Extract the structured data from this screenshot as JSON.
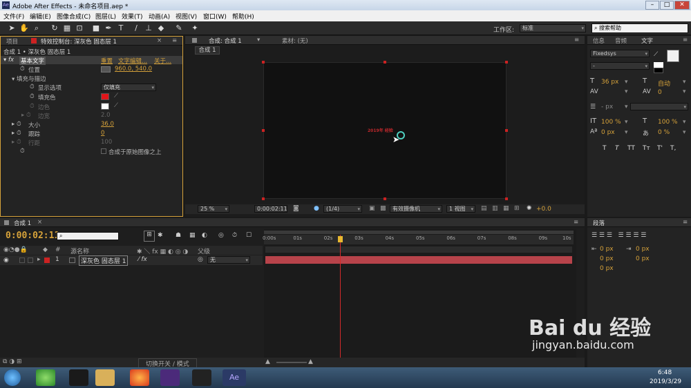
{
  "window": {
    "title": "Adobe After Effects - 未命名项目.aep *",
    "logo": "Ae"
  },
  "menu": [
    "文件(F)",
    "编辑(E)",
    "图像合成(C)",
    "图层(L)",
    "效果(T)",
    "动画(A)",
    "视图(V)",
    "窗口(W)",
    "帮助(H)"
  ],
  "toolbar": {
    "workspace_label": "工作区:",
    "workspace_value": "标准",
    "search_placeholder": "搜索帮助"
  },
  "left_panel": {
    "tab_project": "项目",
    "tab_effects": "特效控制台: 深灰色 固态层 1",
    "breadcrumb": "合成 1 • 深灰色 固态层 1",
    "effect_name": "基本文字",
    "links": [
      "重置",
      "文字编辑...",
      "关于..."
    ],
    "props": {
      "position": {
        "label": "位置",
        "value": "960.0, 540.0"
      },
      "fill_stroke": "填充与描边",
      "display_options": {
        "label": "显示选项",
        "value": "仅填充"
      },
      "fill_color": {
        "label": "填充色"
      },
      "stroke_color": {
        "label": "边色"
      },
      "stroke_width": {
        "label": "边宽",
        "value": "2.0"
      },
      "size": {
        "label": "大小",
        "value": "36.0"
      },
      "tracking": {
        "label": "跟踪",
        "value": "0"
      },
      "leading": {
        "label": "行距",
        "value": "100"
      },
      "composite": {
        "label": "合成于原始图像之上"
      }
    }
  },
  "viewer": {
    "tab_comp": "合成: 合成 1",
    "tab_footage": "素材: (无)",
    "comp_tab": "合成 1",
    "canvas_text": "2019年 经验",
    "zoom": "25 %",
    "timecode": "0:00:02:11",
    "resolution": "(1/4)",
    "camera": "有效摄像机",
    "views": "1 视图",
    "exposure": "+0.0"
  },
  "right_panel": {
    "tabs": [
      "信息",
      "音频",
      "文字"
    ],
    "font_name": "Fixedsys",
    "font_style": "-",
    "size": "36 px",
    "leading": "自动",
    "kerning": "",
    "tracking": "0",
    "stroke_width": "- px",
    "v_scale": "100 %",
    "h_scale": "100 %",
    "baseline": "0 px",
    "tsume": "0 %",
    "style_buttons": [
      "T",
      "T",
      "TT",
      "Tт",
      "T'",
      "T,"
    ]
  },
  "timeline": {
    "tab": "合成 1",
    "timecode": "0:00:02:11",
    "columns": {
      "num": "#",
      "source": "源名称",
      "parent": "父级"
    },
    "layer": {
      "index": "1",
      "name": "深灰色 固态层 1",
      "parent": "无"
    },
    "ruler": [
      "0:00s",
      "01s",
      "02s",
      "03s",
      "04s",
      "05s",
      "06s",
      "07s",
      "08s",
      "09s",
      "10s"
    ],
    "playhead_seconds": 2.44,
    "duration_seconds": 10,
    "toggle_label": "切换开关 / 模式"
  },
  "paragraph": {
    "tab": "段落",
    "values": [
      "0 px",
      "0 px",
      "0 px",
      "0 px",
      "0 px"
    ]
  },
  "watermark": {
    "brand": "Bai du 经验",
    "url": "jingyan.baidu.com"
  },
  "taskbar": {
    "time": "6:48",
    "date": "2019/3/29"
  },
  "colors": {
    "accent_orange": "#d6a23a",
    "fill_red": "#e0151a",
    "layer_bar": "#b7434a",
    "playhead": "#d42a2a"
  }
}
